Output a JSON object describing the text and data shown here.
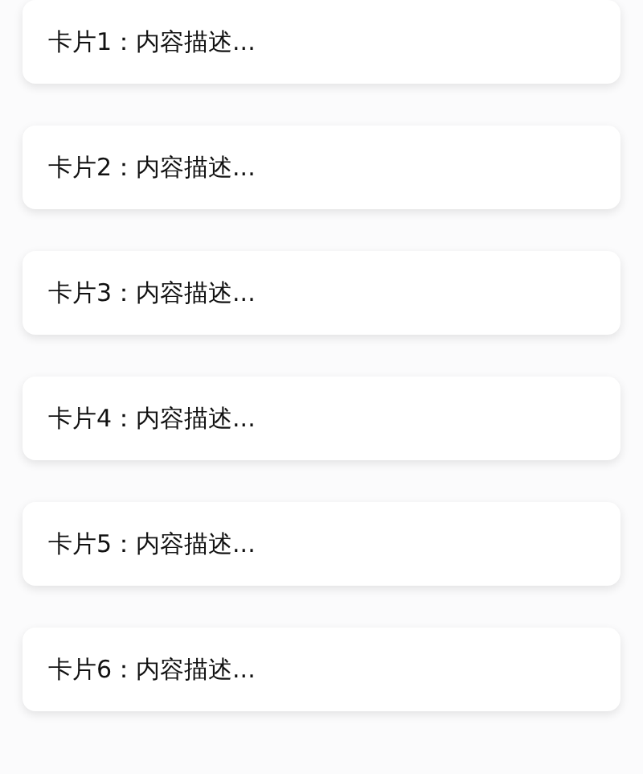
{
  "cards": [
    {
      "text": "卡片1：内容描述..."
    },
    {
      "text": "卡片2：内容描述..."
    },
    {
      "text": "卡片3：内容描述..."
    },
    {
      "text": "卡片4：内容描述..."
    },
    {
      "text": "卡片5：内容描述..."
    },
    {
      "text": "卡片6：内容描述..."
    }
  ]
}
